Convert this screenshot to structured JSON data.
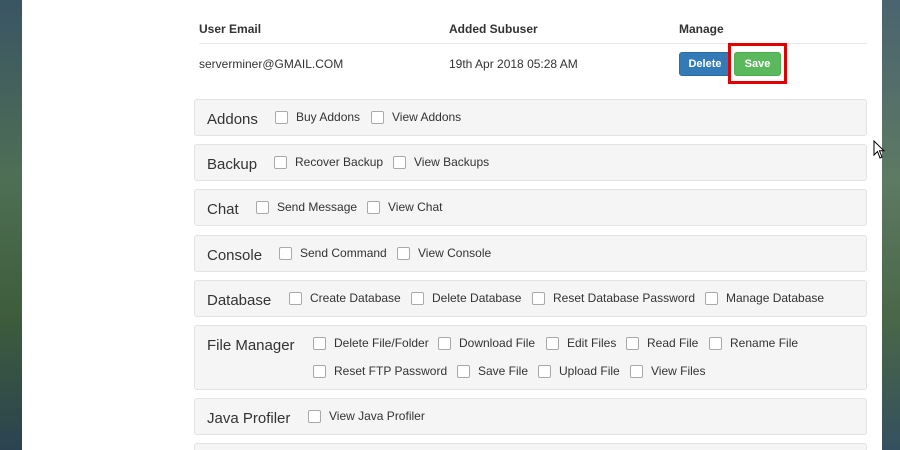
{
  "table": {
    "headers": [
      "User Email",
      "Added Subuser",
      "Manage"
    ],
    "row": {
      "email": "serverminer@GMAIL.COM",
      "added": "19th Apr 2018 05:28 AM",
      "delete_label": "Delete",
      "save_label": "Save"
    }
  },
  "groups": [
    {
      "title": "Addons",
      "perms": [
        "Buy Addons",
        "View Addons"
      ]
    },
    {
      "title": "Backup",
      "perms": [
        "Recover Backup",
        "View Backups"
      ]
    },
    {
      "title": "Chat",
      "perms": [
        "Send Message",
        "View Chat"
      ]
    },
    {
      "title": "Console",
      "perms": [
        "Send Command",
        "View Console"
      ]
    },
    {
      "title": "Database",
      "perms": [
        "Create Database",
        "Delete Database",
        "Reset Database Password",
        "Manage Database"
      ]
    },
    {
      "title": "File Manager",
      "perms": [
        "Delete File/Folder",
        "Download File",
        "Edit Files",
        "Read File",
        "Rename File",
        "Reset FTP Password",
        "Save File",
        "Upload File",
        "View Files"
      ]
    },
    {
      "title": "Java Profiler",
      "perms": [
        "View Java Profiler"
      ]
    }
  ],
  "colors": {
    "delete_button": "#337ab7",
    "save_button": "#5cb85c",
    "highlight": "#e00000"
  }
}
